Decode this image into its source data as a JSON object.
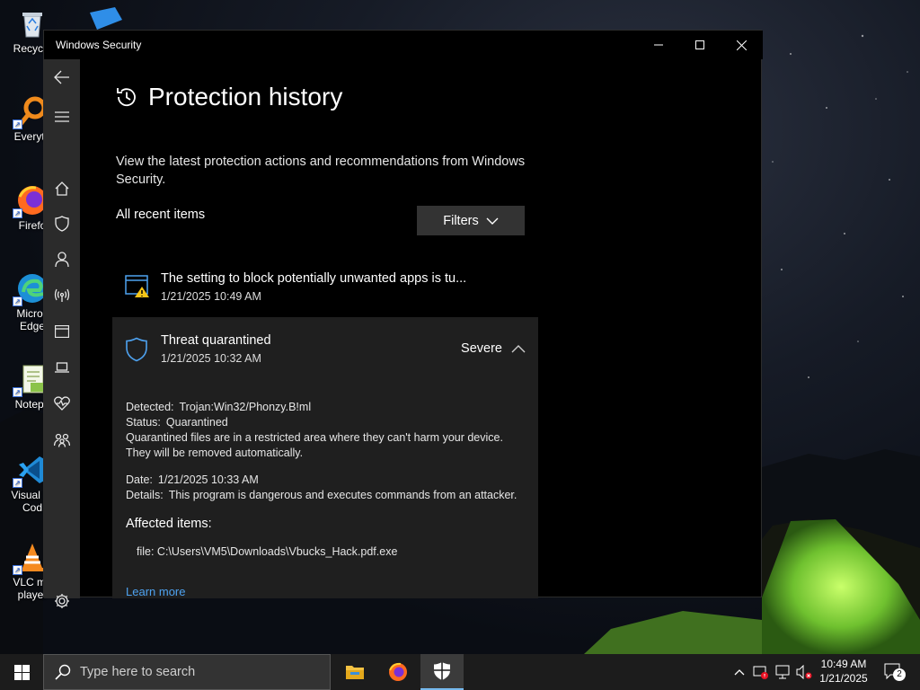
{
  "desktop": {
    "icons": [
      {
        "label": "Recycle"
      },
      {
        "label": "Everyth"
      },
      {
        "label": "Firefo"
      },
      {
        "label": "Micros Edge"
      },
      {
        "label": "Notepa"
      },
      {
        "label": "Visual St Cod"
      },
      {
        "label": "VLC me player"
      }
    ]
  },
  "window": {
    "title": "Windows Security",
    "minimize_glyph": "—",
    "maximize_glyph": "☐",
    "close_glyph": "✕"
  },
  "page": {
    "title": "Protection history",
    "description": "View the latest protection actions and recommendations from Windows Security.",
    "section_label": "All recent items",
    "filters_label": "Filters"
  },
  "entries": [
    {
      "title": "The setting to block potentially unwanted apps is tu...",
      "date": "1/21/2025 10:49 AM"
    },
    {
      "title": "Threat quarantined",
      "date": "1/21/2025 10:32 AM",
      "severity": "Severe",
      "detected_key": "Detected:",
      "detected_val": "Trojan:Win32/Phonzy.B!ml",
      "status_key": "Status:",
      "status_val": "Quarantined",
      "status_note": "Quarantined files are in a restricted area where they can't harm your device. They will be removed automatically.",
      "date_key": "Date:",
      "date_val": "1/21/2025 10:33 AM",
      "details_key": "Details:",
      "details_val": "This program is dangerous and executes commands from an attacker.",
      "affected_title": "Affected items:",
      "affected_file": "file: C:\\Users\\VM5\\Downloads\\Vbucks_Hack.pdf.exe",
      "learn_more": "Learn more"
    }
  ],
  "taskbar": {
    "search_placeholder": "Type here to search",
    "time": "10:49 AM",
    "date": "1/21/2025",
    "notification_count": "2"
  },
  "colors": {
    "accent": "#4ea2f0",
    "warning": "#f5c518",
    "nav_bg": "#2b2b2b",
    "expanded_bg": "#1f1f1f"
  }
}
